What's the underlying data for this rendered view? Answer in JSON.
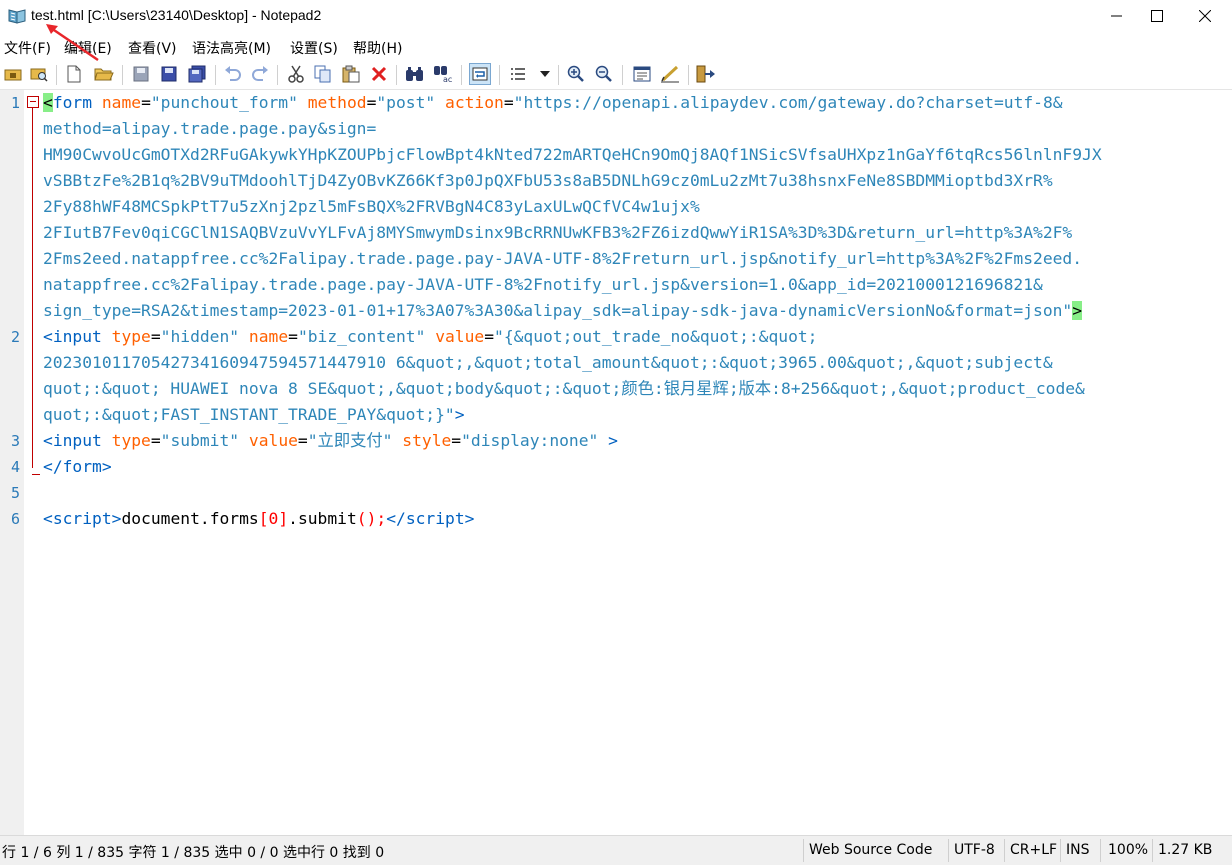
{
  "window": {
    "title": "test.html [C:\\Users\\23140\\Desktop] - Notepad2"
  },
  "menu": {
    "items": [
      "文件(F)",
      "编辑(E)",
      "查看(V)",
      "语法高亮(M)",
      "设置(S)",
      "帮助(H)"
    ]
  },
  "toolbar": {
    "buttons": [
      "open-folder-icon",
      "browse-icon",
      "new-file-icon",
      "open-file-icon",
      "save-icon",
      "save-as-icon",
      "save-copy-icon",
      "undo-icon",
      "redo-icon",
      "cut-icon",
      "copy-icon",
      "paste-icon",
      "delete-icon",
      "find-icon",
      "replace-icon",
      "word-wrap-icon",
      "view-options-icon",
      "zoom-in-icon",
      "zoom-out-icon",
      "scheme-icon",
      "customize-icon",
      "exit-icon"
    ]
  },
  "editor": {
    "line_numbers": [
      "1",
      "2",
      "3",
      "4",
      "5",
      "6"
    ],
    "line1": {
      "tag_open": "form",
      "attr_name": "name",
      "val_name": "\"punchout_form\"",
      "attr_method": "method",
      "val_method": "\"post\"",
      "attr_action": "action",
      "val_action_start": "\"https://openapi.alipaydev.com/gateway.do?charset=utf-8&",
      "wraps": [
        "method=alipay.trade.page.pay&sign=",
        "HM90CwvoUcGmOTXd2RFuGAkywkYHpKZOUPbjcFlowBpt4kNted722mARTQeHCn9OmQj8AQf1NSicSVfsaUHXpz1nGaYf6tqRcs56lnlnF9JX",
        "vSBBtzFe%2B1q%2BV9uTMdoohlTjD4ZyOBvKZ66Kf3p0JpQXFbU53s8aB5DNLhG9cz0mLu2zMt7u38hsnxFeNe8SBDMMioptbd3XrR%",
        "2Fy88hWF48MCSpkPtT7u5zXnj2pzl5mFsBQX%2FRVBgN4C83yLaxULwQCfVC4w1ujx%",
        "2FIutB7Fev0qiCGClN1SAQBVzuVvYLFvAj8MYSmwymDsinx9BcRRNUwKFB3%2FZ6izdQwwYiR1SA%3D%3D&return_url=http%3A%2F%",
        "2Fms2eed.natappfree.cc%2Falipay.trade.page.pay-JAVA-UTF-8%2Freturn_url.jsp&notify_url=http%3A%2F%2Fms2eed.",
        "natappfree.cc%2Falipay.trade.page.pay-JAVA-UTF-8%2Fnotify_url.jsp&version=1.0&app_id=2021000121696821&"
      ],
      "last_wrap": "sign_type=RSA2&timestamp=2023-01-01+17%3A07%3A30&alipay_sdk=alipay-sdk-java-dynamicVersionNo&format=json\""
    },
    "line2": {
      "tag": "input",
      "attr_type": "type",
      "val_type": "\"hidden\"",
      "attr_name": "name",
      "val_name": "\"biz_content\"",
      "attr_value": "value",
      "val_start": "\"{&quot;out_trade_no&quot;:&quot;",
      "wraps": [
        "20230101170542734160947594571447910 6&quot;,&quot;total_amount&quot;:&quot;3965.00&quot;,&quot;subject&",
        "quot;:&quot; HUAWEI nova 8 SE&quot;,&quot;body&quot;:&quot;颜色:银月星辉;版本:8+256&quot;,&quot;product_code&"
      ],
      "val_end": "quot;:&quot;FAST_INSTANT_TRADE_PAY&quot;}\""
    },
    "line3": {
      "tag": "input",
      "attr_type": "type",
      "val_type": "\"submit\"",
      "attr_value": "value",
      "val_value": "\"立即支付\"",
      "attr_style": "style",
      "val_style": "\"display:none\""
    },
    "line4": {
      "tag": "/form"
    },
    "line6": {
      "tag_open": "script",
      "ident1": "document",
      "ident2": "forms",
      "index": "0",
      "ident3": "submit",
      "tag_close": "/script"
    }
  },
  "status": {
    "position": "行 1 / 6  列 1 / 835  字符 1 / 835  选中 0 / 0  选中行 0  找到 0",
    "scheme": "Web Source Code",
    "encoding": "UTF-8",
    "eol": "CR+LF",
    "mode": "INS",
    "zoom": "100%",
    "size": "1.27 KB"
  }
}
